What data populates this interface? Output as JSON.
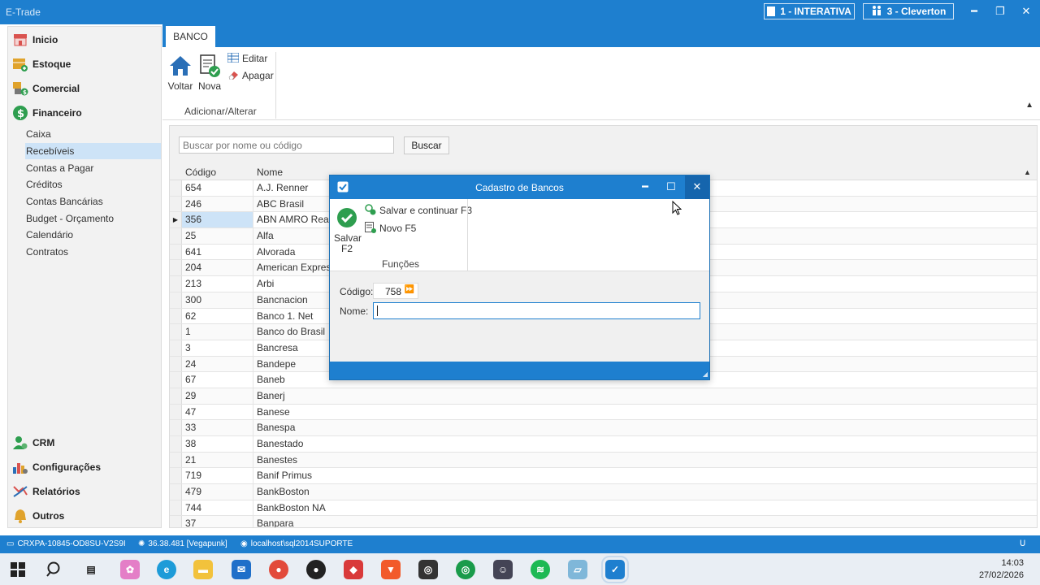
{
  "app": {
    "title": "E-Trade"
  },
  "titlebar": {
    "company": "1 - INTERATIVA",
    "user": "3 - Cleverton"
  },
  "sidebar": {
    "main_items": [
      {
        "label": "Inicio",
        "icon": "store-icon",
        "color": "#d9534f"
      },
      {
        "label": "Estoque",
        "icon": "stock-icon",
        "color": "#e0a32c"
      },
      {
        "label": "Comercial",
        "icon": "commerce-icon",
        "color": "#5b8f3a"
      },
      {
        "label": "Financeiro",
        "icon": "dollar-icon",
        "color": "#2e9e4f"
      }
    ],
    "sub_items": [
      "Caixa",
      "Recebíveis",
      "Contas a Pagar",
      "Créditos",
      "Contas Bancárias",
      "Budget - Orçamento",
      "Calendário",
      "Contratos"
    ],
    "active_sub": "Recebíveis",
    "bottom_items": [
      {
        "label": "CRM",
        "icon": "crm-icon"
      },
      {
        "label": "Configurações",
        "icon": "config-icon"
      },
      {
        "label": "Relatórios",
        "icon": "reports-icon"
      },
      {
        "label": "Outros",
        "icon": "bell-icon"
      }
    ]
  },
  "ribbon": {
    "tab": "BANCO",
    "voltar": "Voltar",
    "nova": "Nova",
    "editar": "Editar",
    "apagar": "Apagar",
    "group": "Adicionar/Alterar"
  },
  "search": {
    "placeholder": "Buscar por nome ou código",
    "button": "Buscar"
  },
  "grid": {
    "columns": [
      "Código",
      "Nome"
    ],
    "rows": [
      [
        "654",
        "A.J. Renner"
      ],
      [
        "246",
        "ABC Brasil"
      ],
      [
        "356",
        "ABN AMRO Real"
      ],
      [
        "25",
        "Alfa"
      ],
      [
        "641",
        "Alvorada"
      ],
      [
        "204",
        "American Express"
      ],
      [
        "213",
        "Arbi"
      ],
      [
        "300",
        "Bancnacion"
      ],
      [
        "62",
        "Banco 1. Net"
      ],
      [
        "1",
        "Banco do Brasil"
      ],
      [
        "3",
        "Bancresa"
      ],
      [
        "24",
        "Bandepe"
      ],
      [
        "67",
        "Baneb"
      ],
      [
        "29",
        "Banerj"
      ],
      [
        "47",
        "Banese"
      ],
      [
        "33",
        "Banespa"
      ],
      [
        "38",
        "Banestado"
      ],
      [
        "21",
        "Banestes"
      ],
      [
        "719",
        "Banif Primus"
      ],
      [
        "479",
        "BankBoston"
      ],
      [
        "744",
        "BankBoston NA"
      ],
      [
        "37",
        "Banpara"
      ]
    ],
    "selected_index": 2
  },
  "dialog": {
    "title": "Cadastro de Bancos",
    "salvar": "Salvar",
    "salvar_key": "F2",
    "salvar_continuar": "Salvar e continuar F3",
    "novo": "Novo F5",
    "group": "Funções",
    "codigo_label": "Código:",
    "codigo_value": "758",
    "nome_label": "Nome:",
    "nome_value": ""
  },
  "statusbar": {
    "machine": "CRXPA-10845-OD8SU-V2S9I",
    "version": "36.38.481 [Vegapunk]",
    "server": "localhost\\sql2014SUPORTE"
  },
  "taskbar": {
    "time": "14:03",
    "date": "27/02/2026"
  },
  "colors": {
    "accent": "#1e7fcf",
    "selection": "#cde3f7",
    "ok_green": "#2e9e4f"
  }
}
